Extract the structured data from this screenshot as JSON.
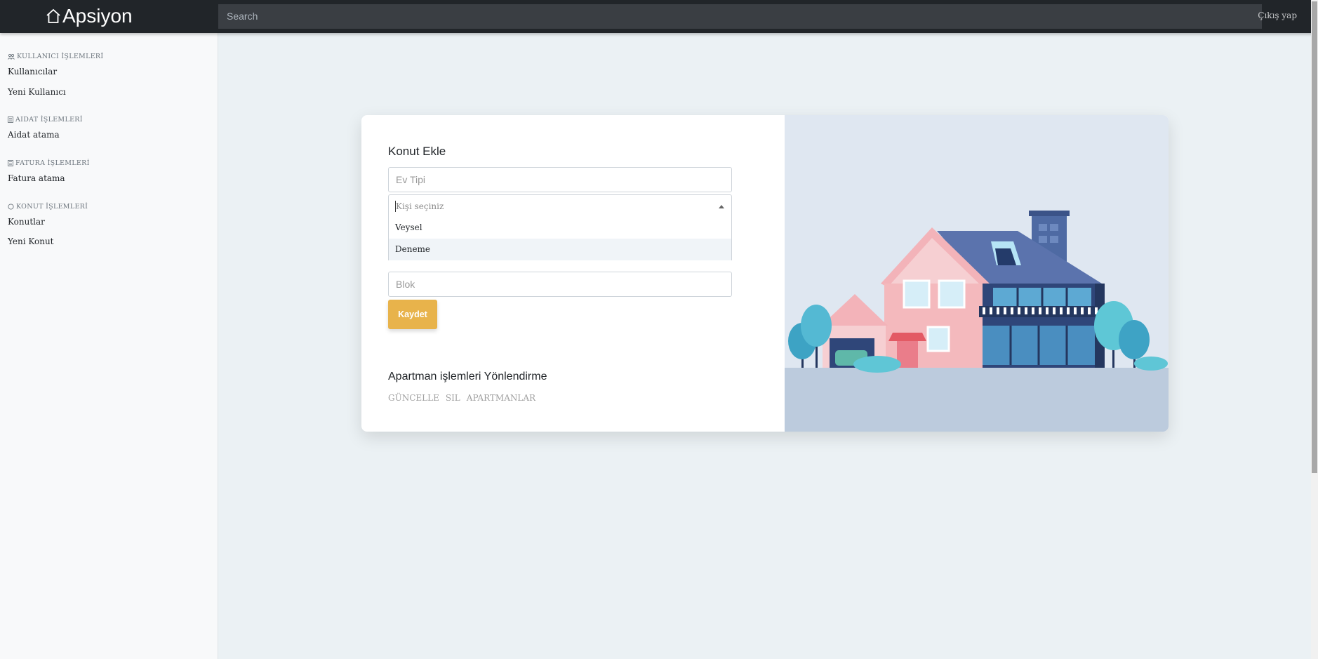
{
  "navbar": {
    "brand": "Apsiyon",
    "search_placeholder": "Search",
    "signout_label": "Çıkış yap"
  },
  "sidebar": {
    "sections": [
      {
        "heading": "KULLANICI İŞLEMLERİ",
        "icon": "users-icon",
        "items": [
          "Kullanıcılar",
          "Yeni Kullanıcı"
        ]
      },
      {
        "heading": "AIDAT İŞLEMLERİ",
        "icon": "calculator-icon",
        "items": [
          "Aidat atama"
        ]
      },
      {
        "heading": "FATURA İŞLEMLERİ",
        "icon": "calculator-icon",
        "items": [
          "Fatura atama"
        ]
      },
      {
        "heading": "KONUT İŞLEMLERİ",
        "icon": "circle-icon",
        "items": [
          "Konutlar",
          "Yeni Konut"
        ]
      }
    ]
  },
  "form": {
    "title": "Konut Ekle",
    "ev_tipi_placeholder": "Ev Tipi",
    "select_placeholder": "Kişi seçiniz",
    "dropdown_options": [
      "Veysel",
      "Deneme"
    ],
    "dropdown_highlighted": "Deneme",
    "blok_placeholder": "Blok",
    "save_label": "Kaydet"
  },
  "redirect": {
    "title": "Apartman işlemleri Yönlendirme",
    "links": [
      "GÜNCELLE",
      "SIL",
      "APARTMANLAR"
    ]
  },
  "colors": {
    "navbar_bg": "#212529",
    "save_button": "#e8b34b",
    "page_bg": "#ebf1f4"
  }
}
